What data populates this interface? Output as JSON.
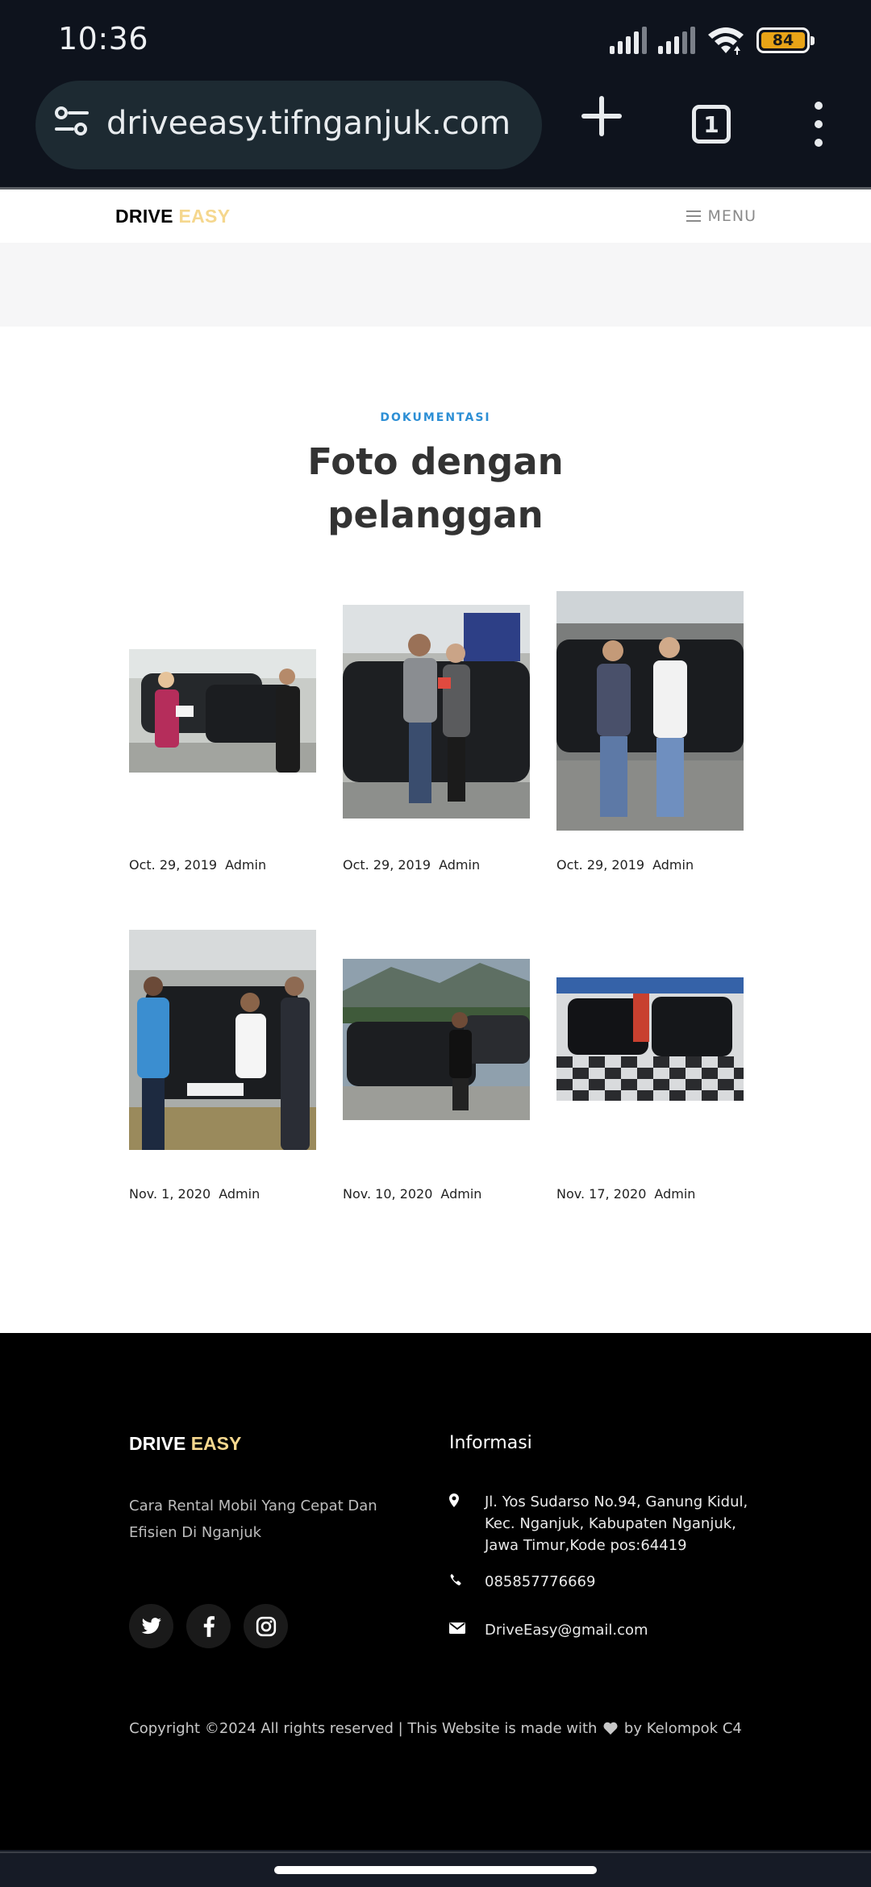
{
  "status_bar": {
    "time": "10:36",
    "battery_level": "84"
  },
  "browser": {
    "url": "driveeasy.tifnganjuk.com",
    "tab_count": "1"
  },
  "site": {
    "brand_part1": "DRIVE",
    "brand_part2": "EASY",
    "menu_label": "MENU"
  },
  "section": {
    "kicker": "DOKUMENTASI",
    "title": "Foto dengan pelanggan"
  },
  "gallery": [
    {
      "date": "Oct. 29, 2019",
      "author": "Admin",
      "photo": "customer-photo-1"
    },
    {
      "date": "Oct. 29, 2019",
      "author": "Admin",
      "photo": "customer-photo-2"
    },
    {
      "date": "Oct. 29, 2019",
      "author": "Admin",
      "photo": "customer-photo-3"
    },
    {
      "date": "Nov. 1, 2020",
      "author": "Admin",
      "photo": "customer-photo-4"
    },
    {
      "date": "Nov. 10, 2020",
      "author": "Admin",
      "photo": "customer-photo-5"
    },
    {
      "date": "Nov. 17, 2020",
      "author": "Admin",
      "photo": "customer-photo-6"
    }
  ],
  "footer": {
    "brand_part1": "DRIVE",
    "brand_part2": "EASY",
    "tagline": "Cara Rental Mobil Yang Cepat Dan Efisien Di Nganjuk",
    "info_title": "Informasi",
    "address": "Jl. Yos Sudarso No.94, Ganung Kidul, Kec. Nganjuk, Kabupaten Nganjuk, Jawa Timur,Kode pos:64419",
    "phone": "085857776669",
    "email": "DriveEasy@gmail.com",
    "copyright_before": "Copyright ©2024 All rights reserved | This Website is made with",
    "copyright_after": "by Kelompok C4",
    "socials": [
      "twitter-icon",
      "facebook-icon",
      "instagram-icon"
    ]
  },
  "colors": {
    "brand_accent": "#f5d78e",
    "kicker_blue": "#2d8fd5",
    "battery": "#e8a317"
  }
}
